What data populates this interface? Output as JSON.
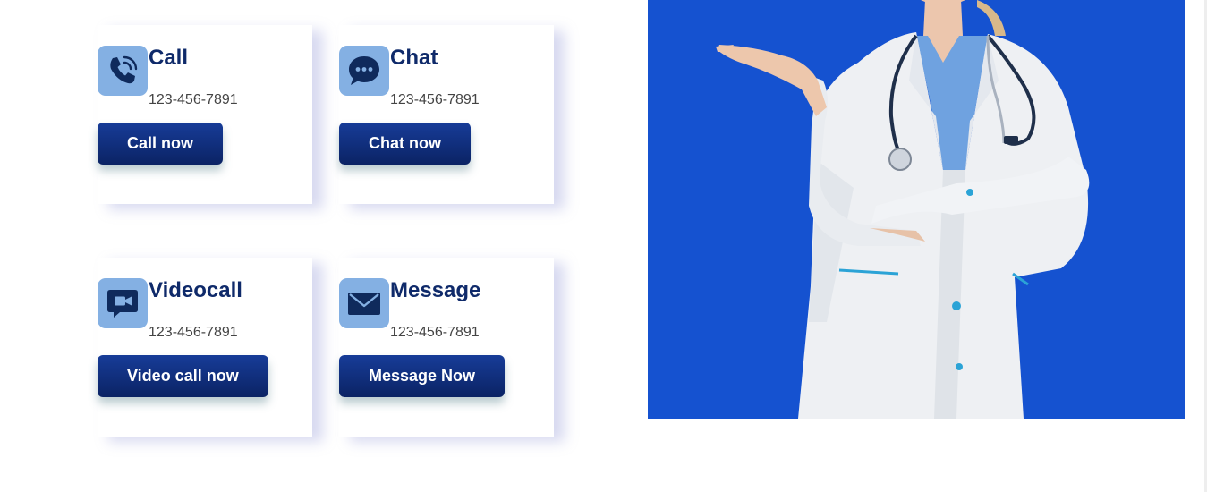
{
  "colors": {
    "accent": "#0f2a6a",
    "button_top": "#173c98",
    "button_bottom": "#0b2364",
    "icon_box": "#84b0e3",
    "icon_fill": "#0f2a5c",
    "hero_bg": "#1552d0"
  },
  "cards": [
    {
      "icon": "phone-icon",
      "title": "Call",
      "phone": "123-456-7891",
      "button": "Call now"
    },
    {
      "icon": "chat-bubble-icon",
      "title": "Chat",
      "phone": "123-456-7891",
      "button": "Chat now"
    },
    {
      "icon": "video-camera-icon",
      "title": "Videocall",
      "phone": "123-456-7891",
      "button": "Video call now"
    },
    {
      "icon": "envelope-icon",
      "title": "Message",
      "phone": "123-456-7891",
      "button": "Message Now"
    }
  ]
}
